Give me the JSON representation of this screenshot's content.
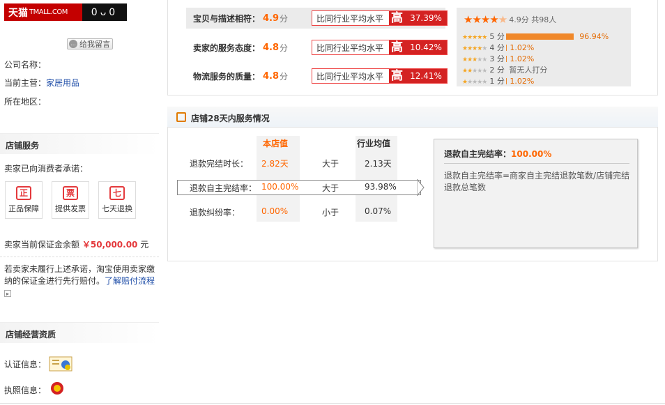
{
  "brand": {
    "cn": "天猫",
    "en": "TMALL.COM",
    "cat_face": "0ᴗ0"
  },
  "left": {
    "message_button": "给我留言",
    "company_label": "公司名称：",
    "main_business_label": "当前主营：",
    "main_business_value": "家居用品",
    "region_label": "所在地区：",
    "shop_services_title": "店铺服务",
    "promise_text": "卖家已向消费者承诺：",
    "services": [
      {
        "label": "正品保障",
        "icon": "正"
      },
      {
        "label": "提供发票",
        "icon": "票"
      },
      {
        "label": "七天退换",
        "icon": "七"
      }
    ],
    "deposit_prefix": "卖家当前保证金余额",
    "deposit_amount": "￥50,000.00",
    "deposit_unit": "元",
    "notice_text": "若卖家未履行上述承诺，淘宝使用卖家缴纳的保证金进行先行赔付。",
    "notice_link": "了解赔付流程",
    "qualification_title": "店铺经营资质",
    "cert_label": "认证信息：",
    "license_label": "执照信息："
  },
  "dsr": [
    {
      "label": "宝贝与描述相符：",
      "score": "4.9",
      "unit": "分",
      "compare_text": "比同行业平均水平",
      "level": "高",
      "percent": "37.39%"
    },
    {
      "label": "卖家的服务态度：",
      "score": "4.8",
      "unit": "分",
      "compare_text": "比同行业平均水平",
      "level": "高",
      "percent": "10.42%"
    },
    {
      "label": "物流服务的质量：",
      "score": "4.8",
      "unit": "分",
      "compare_text": "比同行业平均水平",
      "level": "高",
      "percent": "12.41%"
    }
  ],
  "rating": {
    "summary": "4.9分 共98人",
    "rows": [
      {
        "stars": 5,
        "label": "5 分",
        "pct": "96.94%",
        "fraction": 0.9694
      },
      {
        "stars": 4,
        "label": "4 分",
        "pct": "1.02%",
        "fraction": 0.0102
      },
      {
        "stars": 3,
        "label": "3 分",
        "pct": "1.02%",
        "fraction": 0.0102
      },
      {
        "stars": 2,
        "label": "2 分",
        "pct": "暂无人打分",
        "fraction": 0
      },
      {
        "stars": 1,
        "label": "1 分",
        "pct": "1.02%",
        "fraction": 0.0102
      }
    ]
  },
  "service28": {
    "title": "店铺28天内服务情况",
    "col_store": "本店值",
    "col_industry": "行业均值",
    "rows": [
      {
        "label": "退款完结时长：",
        "store": "2.82天",
        "cmp": "大于",
        "industry": "2.13天"
      },
      {
        "label": "退款自主完结率：",
        "store": "100.00%",
        "cmp": "大于",
        "industry": "93.98%"
      },
      {
        "label": "退款纠纷率：",
        "store": "0.00%",
        "cmp": "小于",
        "industry": "0.07%"
      }
    ],
    "tip": {
      "head_label": "退款自主完结率：",
      "head_value": "100.00%",
      "body": "退款自主完结率=商家自主完结退款笔数/店铺完结退款总笔数"
    }
  },
  "colors": {
    "accent": "#f60",
    "red": "#d42222",
    "tmall": "#c40000",
    "link": "#1f4ea8"
  }
}
